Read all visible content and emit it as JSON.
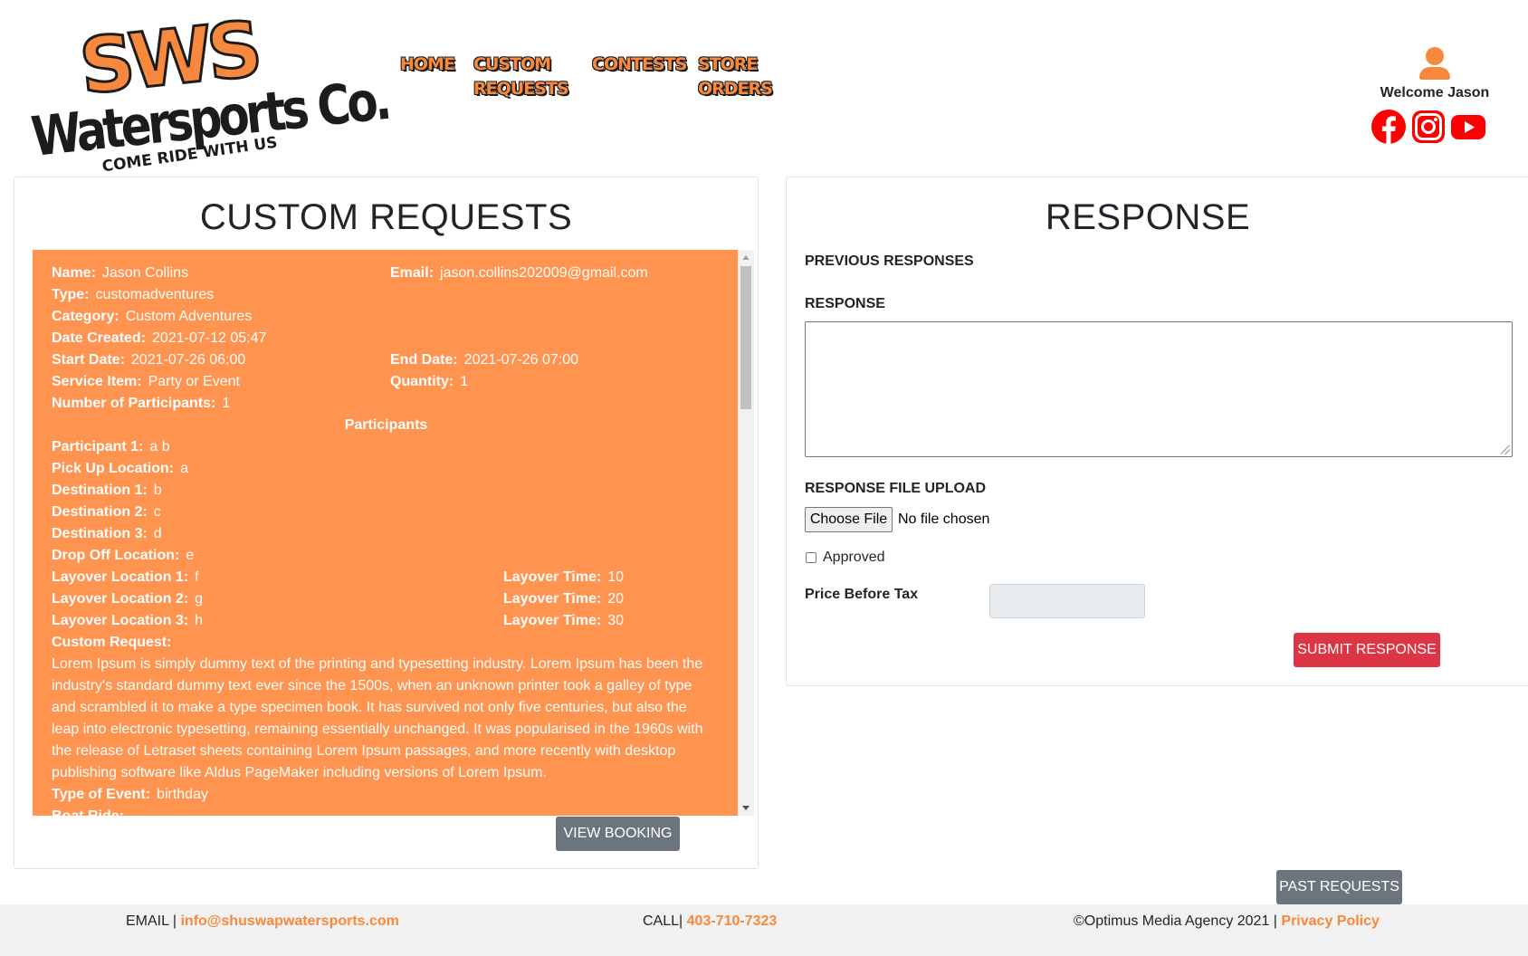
{
  "header": {
    "logo": {
      "main": "SWS",
      "sub": "Watersports Co.",
      "tagline": "COME RIDE WITH US"
    },
    "nav": [
      {
        "label": "HOME"
      },
      {
        "label": "CUSTOM\nREQUESTS"
      },
      {
        "label": "CONTESTS"
      },
      {
        "label": "STORE\nORDERS"
      }
    ],
    "user": {
      "welcome": "Welcome Jason",
      "icon": "user-icon"
    },
    "socials": [
      {
        "name": "facebook-icon",
        "color": "#ff0000"
      },
      {
        "name": "instagram-icon",
        "color": "#ff0000"
      },
      {
        "name": "youtube-icon",
        "color": "#ff0000"
      }
    ]
  },
  "custom_requests": {
    "title": "CUSTOM REQUESTS",
    "name_label": "Name:",
    "name": "Jason Collins",
    "email_label": "Email:",
    "email": "jason.collins202009@gmail.com",
    "type_label": "Type:",
    "type": "customadventures",
    "category_label": "Category:",
    "category": "Custom Adventures",
    "date_created_label": "Date Created:",
    "date_created": "2021-07-12 05:47",
    "start_date_label": "Start Date:",
    "start_date": "2021-07-26 06:00",
    "end_date_label": "End Date:",
    "end_date": "2021-07-26 07:00",
    "service_item_label": "Service Item:",
    "service_item": "Party or Event",
    "quantity_label": "Quantity:",
    "quantity": "1",
    "participants_count_label": "Number of Participants:",
    "participants_count": "1",
    "participants_heading": "Participants",
    "participant1_label": "Participant 1:",
    "participant1": "a b",
    "pickup_label": "Pick Up Location:",
    "pickup": "a",
    "destination1_label": "Destination 1:",
    "destination1": "b",
    "destination2_label": "Destination 2:",
    "destination2": "c",
    "destination3_label": "Destination 3:",
    "destination3": "d",
    "dropoff_label": "Drop Off Location:",
    "dropoff": "e",
    "layovers": [
      {
        "location_label": "Layover Location 1:",
        "location": "f",
        "time_label": "Layover Time:",
        "time": "10"
      },
      {
        "location_label": "Layover Location 2:",
        "location": "g",
        "time_label": "Layover Time:",
        "time": "20"
      },
      {
        "location_label": "Layover Location 3:",
        "location": "h",
        "time_label": "Layover Time:",
        "time": "30"
      }
    ],
    "custom_request_label": "Custom Request:",
    "custom_request": "Lorem Ipsum is simply dummy text of the printing and typesetting industry. Lorem Ipsum has been the industry's standard dummy text ever since the 1500s, when an unknown printer took a galley of type and scrambled it to make a type specimen book. It has survived not only five centuries, but also the leap into electronic typesetting, remaining essentially unchanged. It was popularised in the 1960s with the release of Letraset sheets containing Lorem Ipsum passages, and more recently with desktop publishing software like Aldus PageMaker including versions of Lorem Ipsum.",
    "event_type_label": "Type of Event:",
    "event_type": "birthday",
    "boat_ride_label": "Boat Ride:",
    "view_booking": "VIEW BOOKING"
  },
  "response": {
    "title": "RESPONSE",
    "previous_label": "PREVIOUS RESPONSES",
    "response_label": "RESPONSE",
    "file_upload_label": "RESPONSE FILE UPLOAD",
    "choose_file": "Choose File",
    "file_status": "No file chosen",
    "approved_label": "Approved",
    "approved": false,
    "price_label": "Price Before Tax",
    "price_value": "",
    "submit": "SUBMIT RESPONSE",
    "past_requests": "PAST REQUESTS"
  },
  "footer": {
    "email_prefix": "EMAIL |",
    "email": "info@shuswapwatersports.com",
    "call_prefix": "CALL|",
    "phone": "403-710-7323",
    "copyright": "©Optimus Media Agency 2021 |",
    "privacy": "Privacy Policy"
  },
  "colors": {
    "accent": "#f7893e",
    "panel": "#ff9350",
    "danger": "#dc3545",
    "secondary": "#6c757d"
  }
}
